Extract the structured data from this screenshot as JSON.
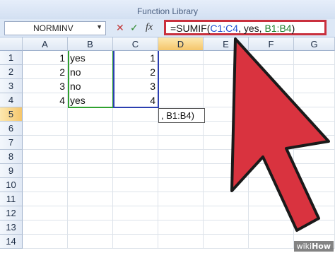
{
  "ribbon": {
    "group_label": "Function Library"
  },
  "formula_bar": {
    "name_box": "NORMINV",
    "cancel_icon": "✕",
    "enter_icon": "✓",
    "fx_icon": "fx",
    "formula_parts": [
      "=SUMIF(",
      "C1:C4",
      ", yes, ",
      "B1:B4",
      ")"
    ]
  },
  "columns": [
    "A",
    "B",
    "C",
    "D",
    "E",
    "F",
    "G"
  ],
  "rows": [
    "1",
    "2",
    "3",
    "4",
    "5",
    "6",
    "7",
    "8",
    "9",
    "10",
    "11",
    "12",
    "13",
    "14"
  ],
  "cells": {
    "A": [
      "1",
      "2",
      "3",
      "4"
    ],
    "B": [
      "yes",
      "no",
      "no",
      "yes"
    ],
    "C": [
      "1",
      "2",
      "3",
      "4"
    ]
  },
  "edit_cell_text": ", B1:B4)",
  "watermark": {
    "prefix": "wiki",
    "suffix": "How"
  },
  "colors": {
    "highlight": "#c9303d",
    "arrow": "#d9333f",
    "range_b": "#2fa12f",
    "range_c": "#2b3fb0"
  }
}
